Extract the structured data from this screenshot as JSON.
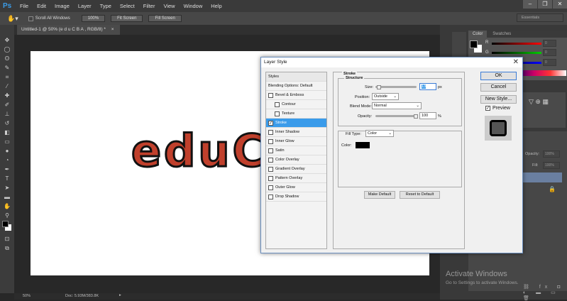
{
  "app": {
    "logo": "Ps",
    "menu": [
      "File",
      "Edit",
      "Image",
      "Layer",
      "Type",
      "Select",
      "Filter",
      "View",
      "Window",
      "Help"
    ],
    "window_buttons": [
      "–",
      "❐",
      "✕"
    ]
  },
  "options": {
    "scroll_all": "Scroll All Windows",
    "zoom100": "100%",
    "fit_screen": "Fit Screen",
    "fill_screen": "Fill Screen",
    "workspace": "Essentials"
  },
  "document": {
    "tab": "Untitled-1 @ 50% (e d u C B A , RGB/8) *",
    "art_text": "eduC",
    "zoom": "50%",
    "doc_size": "Doc: 5.93M/383.8K"
  },
  "color_panel": {
    "tabs": [
      "Color",
      "Swatches"
    ],
    "channels": [
      {
        "label": "R",
        "value": "0"
      },
      {
        "label": "G",
        "value": "0"
      },
      {
        "label": "B",
        "value": "0"
      }
    ]
  },
  "layers_panel": {
    "opacity_label": "Opacity:",
    "opacity": "100%",
    "fill_label": "Fill:",
    "fill": "100%"
  },
  "watermark": {
    "title": "Activate Windows",
    "subtitle": "Go to Settings to activate Windows."
  },
  "dialog": {
    "title": "Layer Style",
    "styles_header": "Styles",
    "blending": "Blending Options: Default",
    "items": [
      {
        "label": "Bevel & Emboss",
        "checked": false
      },
      {
        "label": "Contour",
        "checked": false
      },
      {
        "label": "Texture",
        "checked": false
      },
      {
        "label": "Stroke",
        "checked": true
      },
      {
        "label": "Inner Shadow",
        "checked": false
      },
      {
        "label": "Inner Glow",
        "checked": false
      },
      {
        "label": "Satin",
        "checked": false
      },
      {
        "label": "Color Overlay",
        "checked": false
      },
      {
        "label": "Gradient Overlay",
        "checked": false
      },
      {
        "label": "Pattern Overlay",
        "checked": false
      },
      {
        "label": "Outer Glow",
        "checked": false
      },
      {
        "label": "Drop Shadow",
        "checked": false
      }
    ],
    "section": "Stroke",
    "structure": "Structure",
    "size_label": "Size:",
    "size": "13",
    "size_unit": "px",
    "position_label": "Position:",
    "position": "Outside",
    "blend_label": "Blend Mode:",
    "blend": "Normal",
    "opacity_label": "Opacity:",
    "opacity": "100",
    "opacity_unit": "%",
    "fill_type_label": "Fill Type:",
    "fill_type": "Color",
    "color_label": "Color:",
    "stroke_color": "#000000",
    "make_default": "Make Default",
    "reset_default": "Reset to Default",
    "ok": "OK",
    "cancel": "Cancel",
    "new_style": "New Style...",
    "preview": "Preview",
    "preview_checked": true
  }
}
